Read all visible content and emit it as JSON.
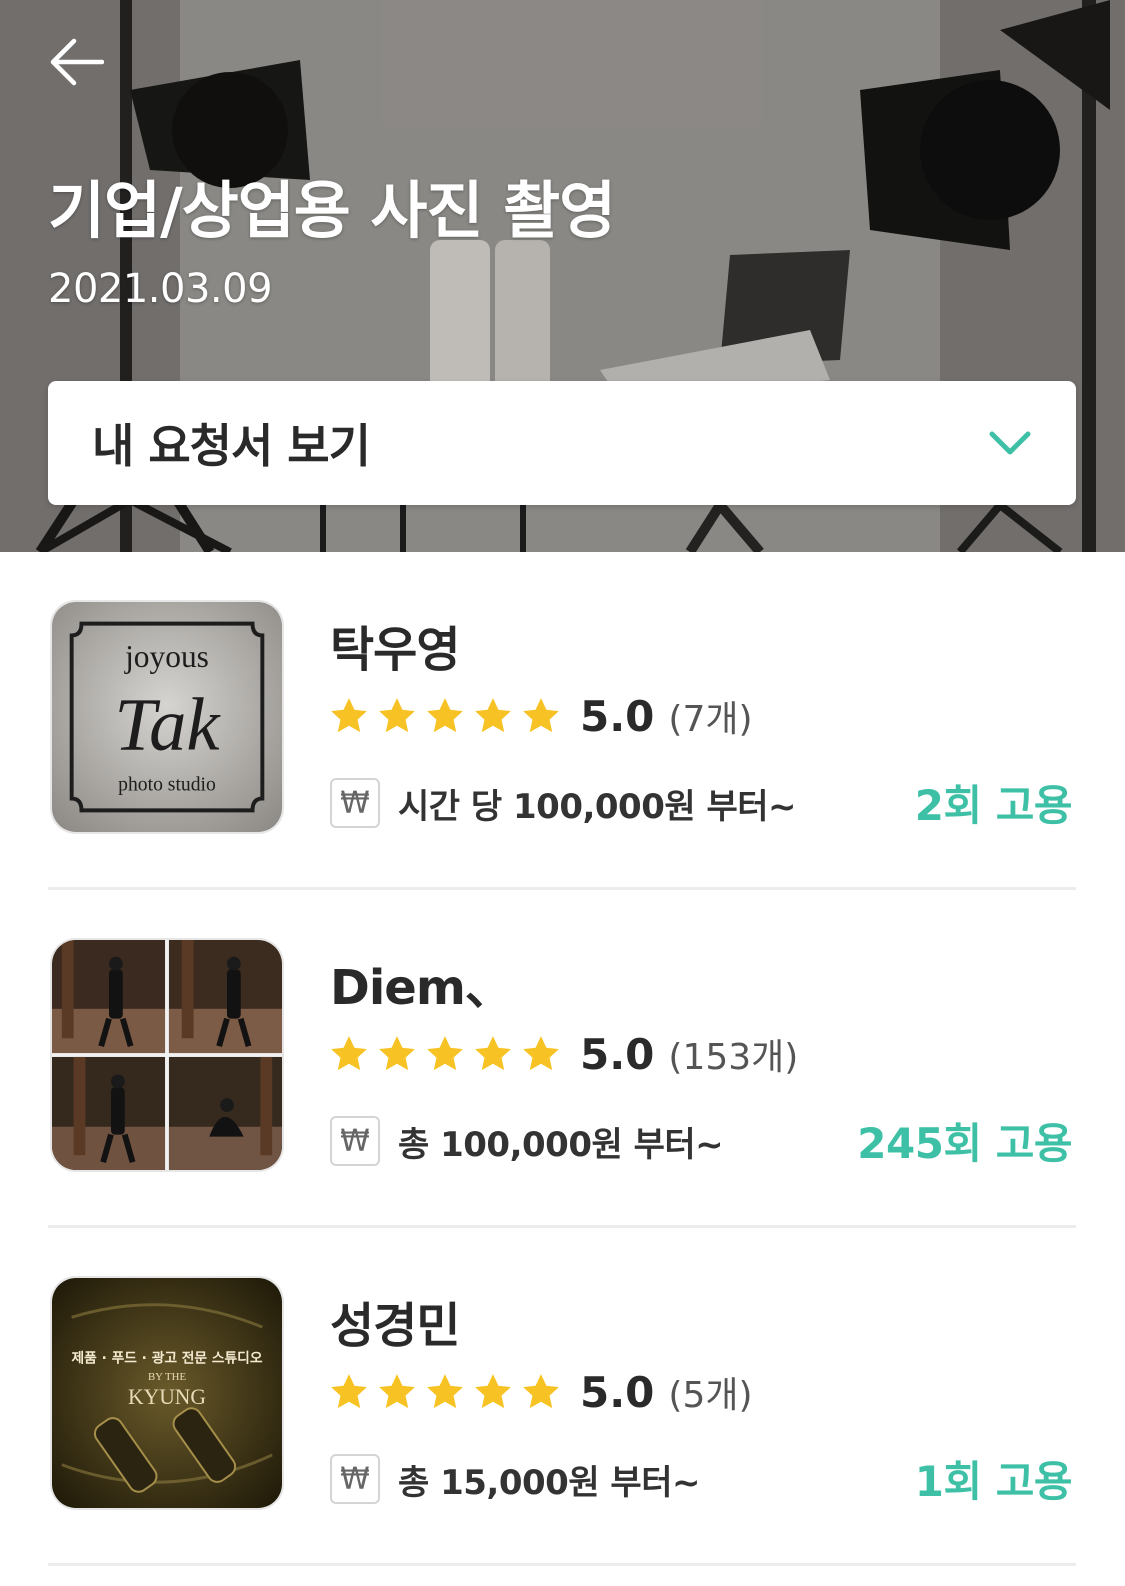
{
  "header": {
    "title": "기업/상업용 사진 촬영",
    "date": "2021.03.09",
    "back_icon": "arrow-left-icon"
  },
  "request": {
    "label": "내 요청서 보기",
    "icon": "chevron-down-icon"
  },
  "colors": {
    "accent": "#3ec0a6",
    "star": "#f7c324"
  },
  "providers": [
    {
      "name": "탁우영",
      "rating": "5.0",
      "review_count": "(7개)",
      "stars": 5,
      "currency_symbol": "₩",
      "price": "시간 당 100,000원 부터~",
      "hires": "2회 고용",
      "thumb_lines": [
        "joyous",
        "Tak",
        "photo studio"
      ]
    },
    {
      "name": "Diem、",
      "rating": "5.0",
      "review_count": "(153개)",
      "stars": 5,
      "currency_symbol": "₩",
      "price": "총 100,000원 부터~",
      "hires": "245회 고용"
    },
    {
      "name": "성경민",
      "rating": "5.0",
      "review_count": "(5개)",
      "stars": 5,
      "currency_symbol": "₩",
      "price": "총 15,000원 부터~",
      "hires": "1회 고용",
      "thumb_lines": [
        "제품 · 푸드 · 광고 전문 스튜디오",
        "BY THE",
        "KYUNG"
      ]
    }
  ]
}
